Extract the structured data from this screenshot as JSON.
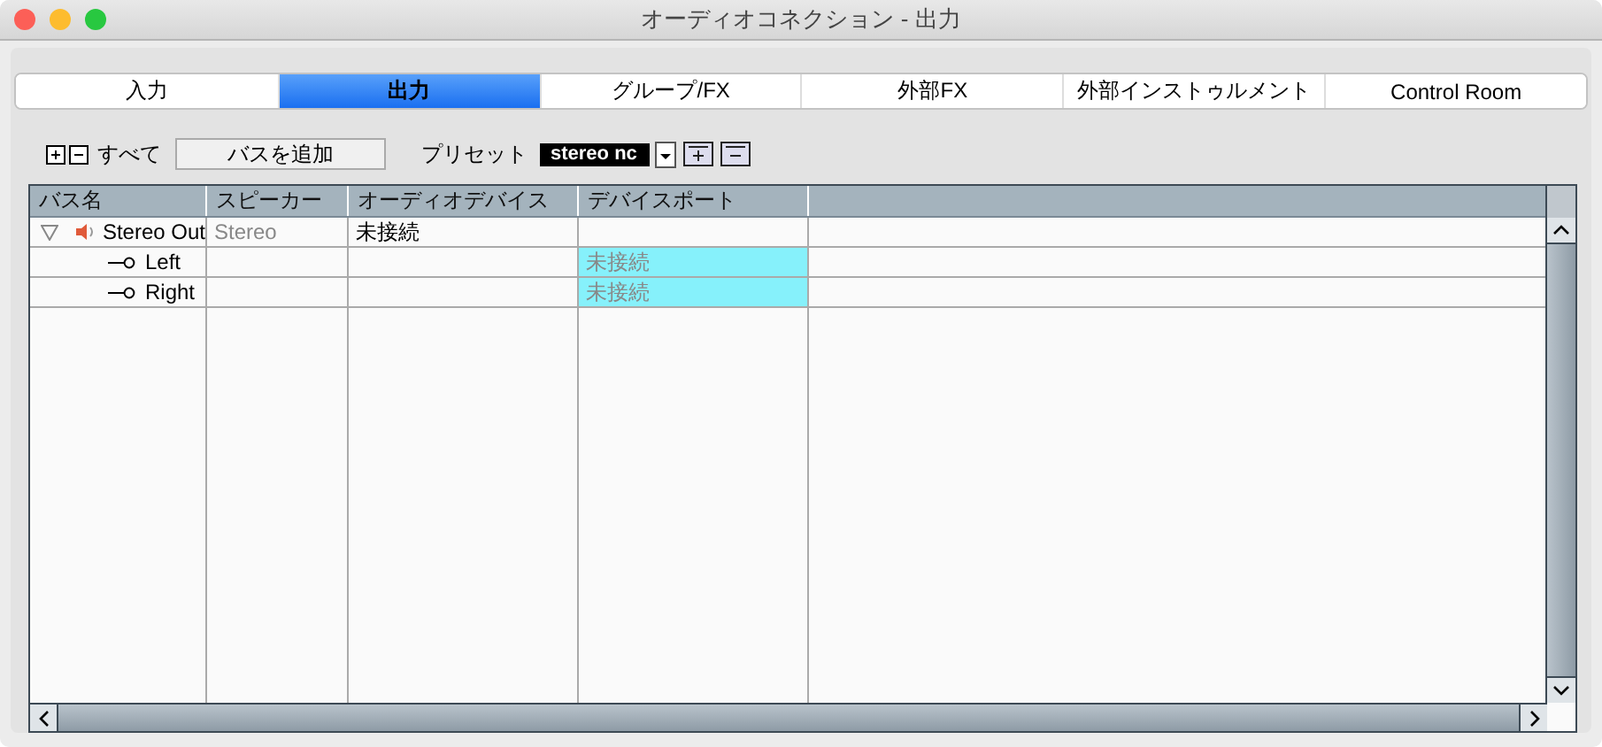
{
  "window": {
    "title": "オーディオコネクション - 出力"
  },
  "tabs": [
    {
      "label": "入力",
      "selected": false
    },
    {
      "label": "出力",
      "selected": true
    },
    {
      "label": "グループ/FX",
      "selected": false
    },
    {
      "label": "外部FX",
      "selected": false
    },
    {
      "label": "外部インストゥルメント",
      "selected": false
    },
    {
      "label": "Control Room",
      "selected": false
    }
  ],
  "toolbar": {
    "all_label": "すべて",
    "add_bus_button": "バスを追加",
    "preset_label": "プリセット",
    "preset_value": "stereo nc"
  },
  "table": {
    "columns": [
      "バス名",
      "スピーカー",
      "オーディオデバイス",
      "デバイスポート"
    ],
    "rows": [
      {
        "name": "Stereo Out",
        "expanded": true,
        "speaker": "Stereo",
        "device": "未接続",
        "port": {
          "highlighted": false
        },
        "children": [
          {
            "name": "Left",
            "port": {
              "text": "未接続",
              "highlighted": true
            }
          },
          {
            "name": "Right",
            "port": {
              "text": "未接続",
              "highlighted": true
            }
          }
        ]
      }
    ]
  }
}
